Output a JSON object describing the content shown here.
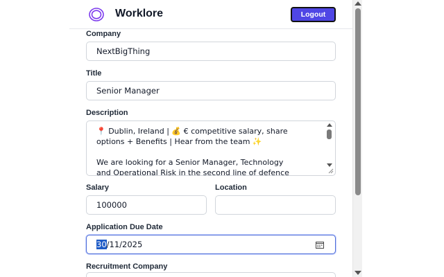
{
  "header": {
    "brand": "Worklore",
    "logout_label": "Logout"
  },
  "form": {
    "company": {
      "label": "Company",
      "value": "NextBigThing"
    },
    "title": {
      "label": "Title",
      "value": "Senior Manager"
    },
    "description": {
      "label": "Description",
      "lines": [
        "📍 Dublin, Ireland | 💰 € competitive salary, share",
        "options + Benefits | Hear from the team ✨",
        "",
        "We are looking for a Senior Manager, Technology",
        "and Operational Risk in the second line of defence"
      ]
    },
    "salary": {
      "label": "Salary",
      "value": "100000"
    },
    "location": {
      "label": "Location",
      "value": ""
    },
    "due_date": {
      "label": "Application Due Date",
      "day": "30",
      "rest": "/11/2025"
    },
    "recruitment_company": {
      "label": "Recruitment Company"
    }
  },
  "icons": {
    "logo": "ring-logo-icon",
    "calendar": "calendar-icon"
  },
  "colors": {
    "accent": "#4f46e5",
    "logo_ring": "#7c3aed",
    "focus_border": "#4f6ed8",
    "selection": "#1e5bc6"
  }
}
